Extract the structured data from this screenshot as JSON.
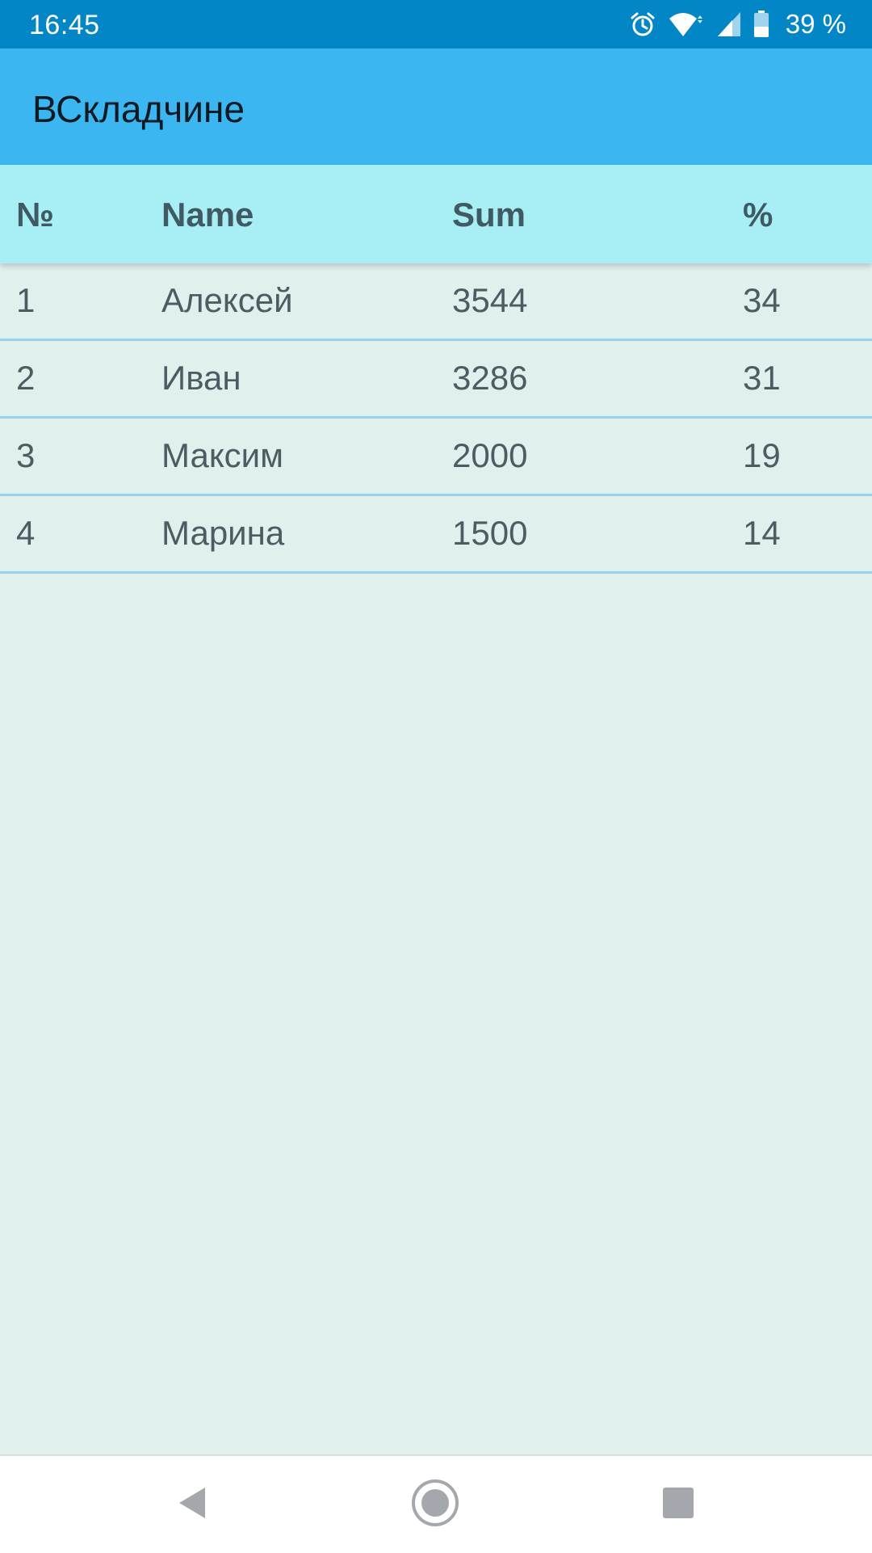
{
  "status_bar": {
    "time": "16:45",
    "battery_percent": "39 %",
    "icons": [
      "alarm-icon",
      "wifi-icon",
      "signal-icon",
      "battery-icon"
    ]
  },
  "app_bar": {
    "title": "ВСкладчине"
  },
  "table": {
    "headers": {
      "num": "№",
      "name": "Name",
      "sum": "Sum",
      "pct": "%"
    },
    "rows": [
      {
        "num": "1",
        "name": "Алексей",
        "sum": "3544",
        "pct": "34"
      },
      {
        "num": "2",
        "name": "Иван",
        "sum": "3286",
        "pct": "31"
      },
      {
        "num": "3",
        "name": "Максим",
        "sum": "2000",
        "pct": "19"
      },
      {
        "num": "4",
        "name": "Марина",
        "sum": "1500",
        "pct": "14"
      }
    ]
  },
  "nav_bar": {
    "icons": [
      "back-icon",
      "home-icon",
      "recent-apps-icon"
    ]
  },
  "colors": {
    "status_bar": "#0286c6",
    "app_bar": "#3bb6f1",
    "table_header": "#a8eff5",
    "background": "#dff0ed",
    "row_divider": "#97d1ef"
  }
}
